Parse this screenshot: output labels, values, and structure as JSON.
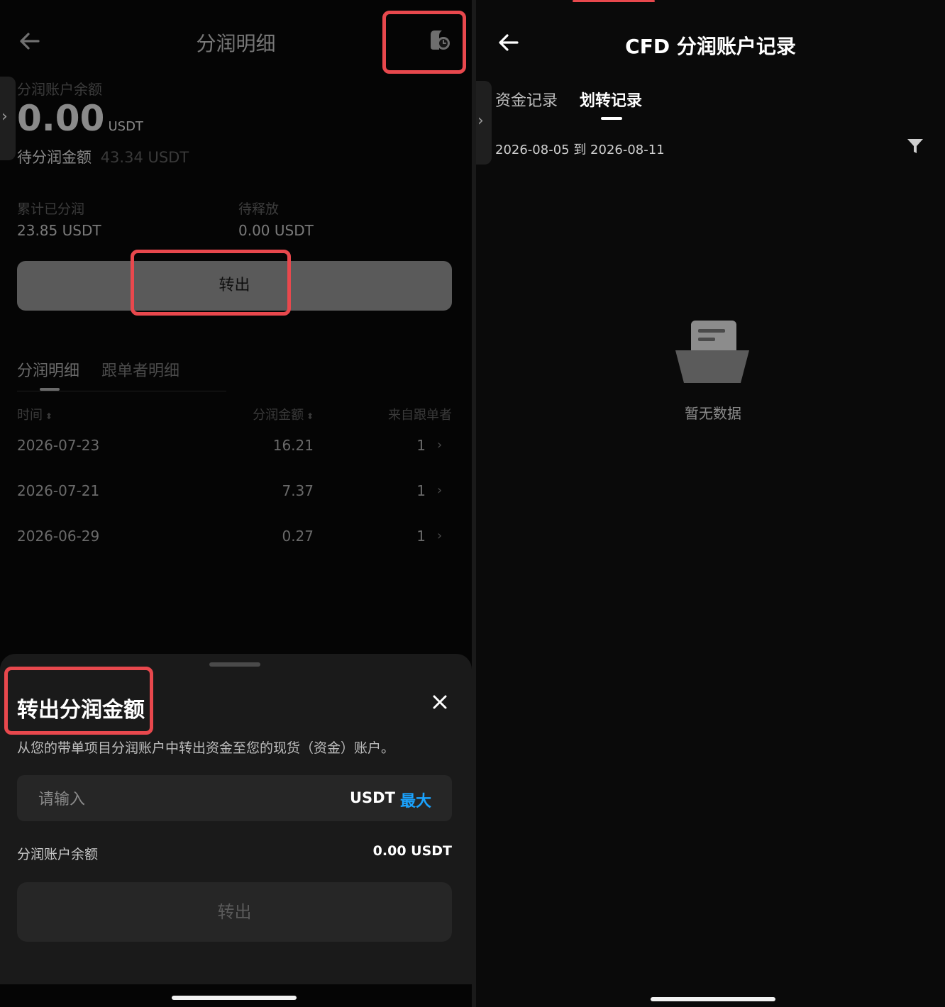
{
  "left": {
    "header": {
      "title": "分润明细"
    },
    "summary": {
      "balance_label": "分润账户余额",
      "balance_value": "0.00",
      "balance_unit": "USDT",
      "pending_label": "待分润金额",
      "pending_value": "43.34 USDT",
      "cumulative_label": "累计已分润",
      "cumulative_value": "23.85 USDT",
      "to_release_label": "待释放",
      "to_release_value": "0.00 USDT"
    },
    "transfer_button_label": "转出",
    "tabs": [
      {
        "label": "分润明细",
        "active": true
      },
      {
        "label": "跟单者明细",
        "active": false
      }
    ],
    "table": {
      "headers": [
        "时间",
        "分润金额",
        "来自跟单者"
      ],
      "rows": [
        [
          "2026-07-23",
          "16.21",
          "1"
        ],
        [
          "2026-07-21",
          "7.37",
          "1"
        ],
        [
          "2026-06-29",
          "0.27",
          "1"
        ]
      ]
    },
    "sheet": {
      "title": "转出分润金额",
      "description": "从您的带单项目分润账户中转出资金至您的现货（资金）账户。",
      "input_placeholder": "请输入",
      "currency": "USDT",
      "max_label": "最大",
      "balance_label": "分润账户余额",
      "balance_value": "0.00 USDT",
      "submit_label": "转出"
    }
  },
  "right": {
    "header": {
      "title": "CFD 分润账户记录"
    },
    "tabs": [
      {
        "label": "资金记录",
        "active": false
      },
      {
        "label": "划转记录",
        "active": true
      }
    ],
    "date_range": "2026-08-05 到 2026-08-11",
    "empty_text": "暂无数据"
  },
  "colors": {
    "highlight": "#e8484d",
    "accent_blue": "#1aa3ff",
    "background": "#000000"
  }
}
